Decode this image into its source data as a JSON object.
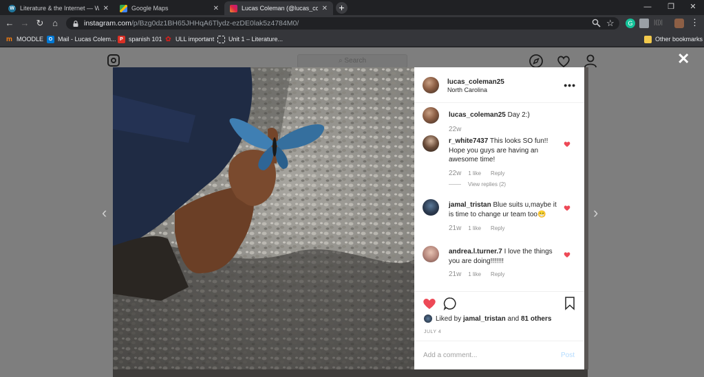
{
  "browser": {
    "tabs": [
      {
        "title": "Literature & the Internet — Wor",
        "favicon": "wordpress-icon",
        "favicon_color": "#21759b"
      },
      {
        "title": "Google Maps",
        "favicon": "maps-icon",
        "favicon_color": "#34a853"
      },
      {
        "title": "Lucas Coleman (@lucas_colemar",
        "favicon": "instagram-icon",
        "favicon_color": "#d6249f"
      }
    ],
    "active_tab_index": 2,
    "url_host": "instagram.com",
    "url_path": "/p/Bzg0dz1BH65JHHqA6Tlydz-ezDE0lak5z4784M0/",
    "bookmarks": [
      {
        "label": "MOODLE",
        "icon": "moodle-icon",
        "color": "#f98012"
      },
      {
        "label": "Mail - Lucas Colem...",
        "icon": "outlook-icon",
        "color": "#0078d4"
      },
      {
        "label": "spanish 101",
        "icon": "pdf-icon",
        "color": "#d93025"
      },
      {
        "label": "ULL important",
        "icon": "ull-icon",
        "color": "#c5221f"
      },
      {
        "label": "Unit 1 – Literature...",
        "icon": "frame-icon",
        "color": "#ffffff"
      }
    ],
    "other_bookmarks": "Other bookmarks"
  },
  "instagram": {
    "search_placeholder": "Search",
    "post": {
      "author": "lucas_coleman25",
      "location": "North Carolina",
      "caption": {
        "user": "lucas_coleman25",
        "text": "Day 2:)",
        "age": "22w"
      },
      "comments": [
        {
          "user": "r_white7437",
          "text": "This looks SO fun!! Hope you guys are having an awesome time!",
          "age": "22w",
          "likes": "1 like",
          "reply": "Reply",
          "view_replies": "View replies (2)",
          "liked": true
        },
        {
          "user": "jamal_tristan",
          "text": "Blue suits u,maybe it is time to change ur team too😁",
          "age": "21w",
          "likes": "1 like",
          "reply": "Reply",
          "liked": true
        },
        {
          "user": "andrea.l.turner.7",
          "text": "I love the things you are doing!!!!!!!",
          "age": "21w",
          "likes": "1 like",
          "reply": "Reply",
          "liked": true
        }
      ],
      "likes_prefix": "Liked by",
      "likes_user": "jamal_tristan",
      "likes_and": "and",
      "likes_others": "81 others",
      "date": "JULY 4",
      "add_comment_placeholder": "Add a comment...",
      "post_button": "Post"
    },
    "colors": {
      "heart_red": "#ed4956",
      "post_disabled": "#b3dbff"
    }
  }
}
